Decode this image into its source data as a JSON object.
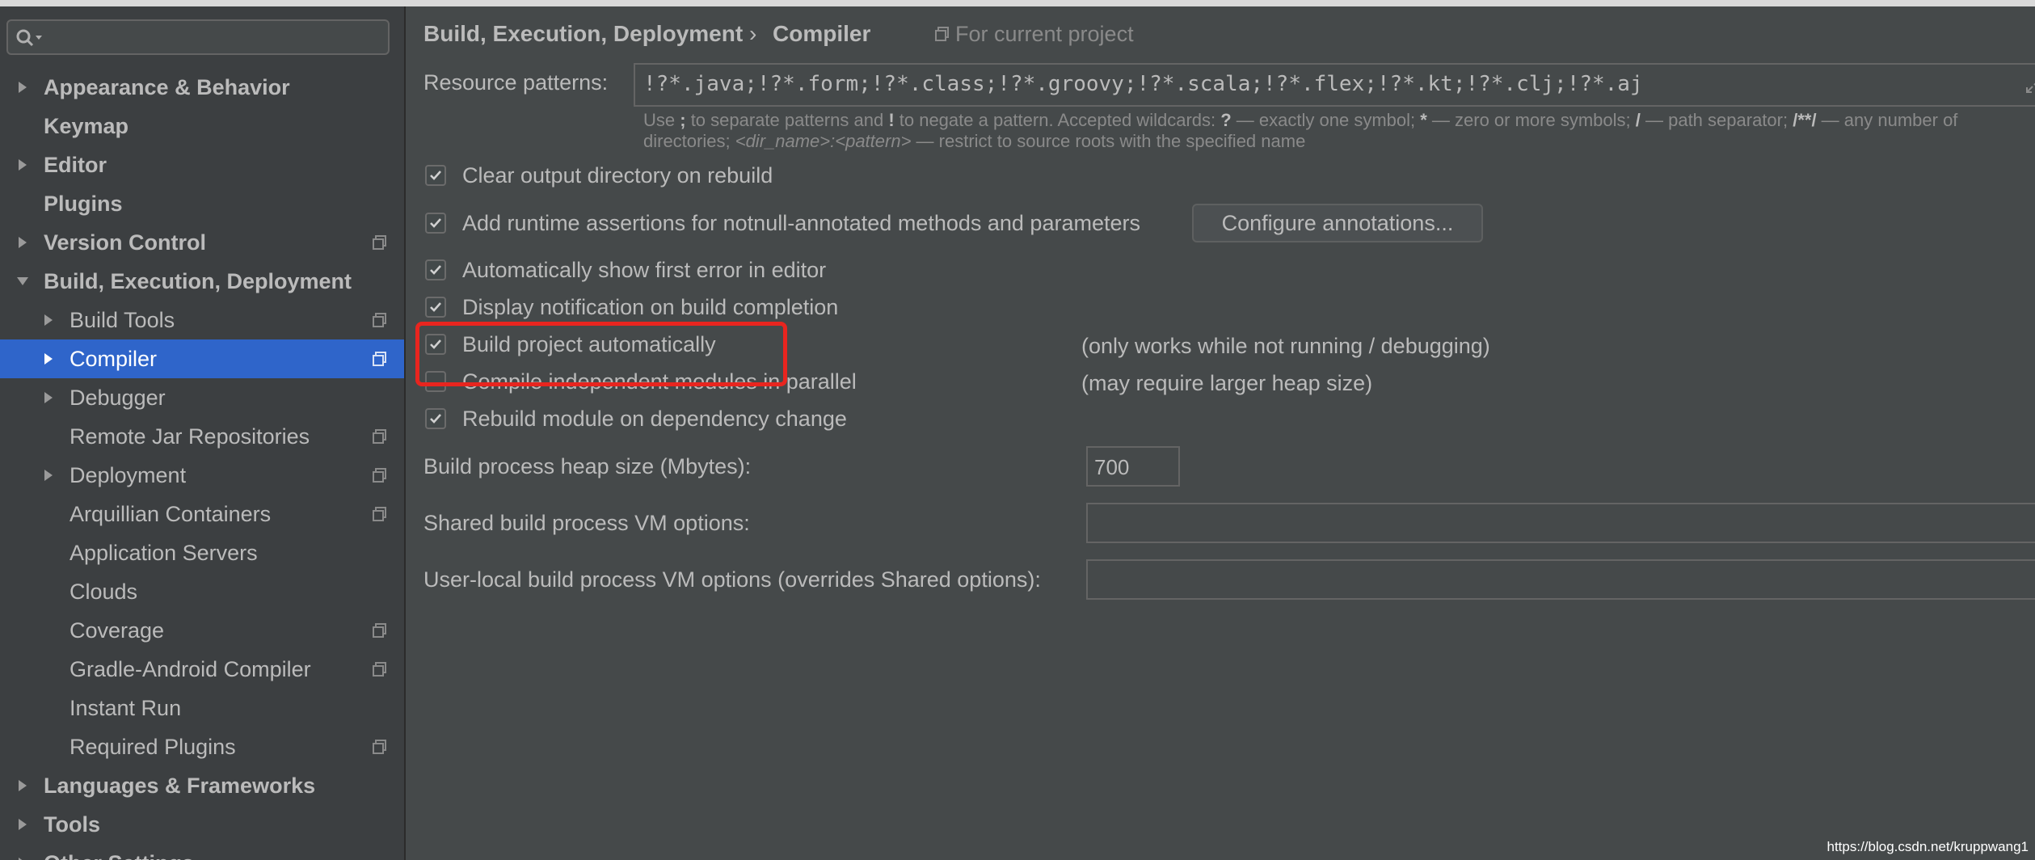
{
  "search": {
    "placeholder": "",
    "value": ""
  },
  "sidebar": {
    "items": [
      {
        "label": "Appearance & Behavior",
        "level": 0,
        "expandable": true,
        "expanded": false,
        "project_icon": false
      },
      {
        "label": "Keymap",
        "level": 0,
        "expandable": false,
        "expanded": false,
        "project_icon": false
      },
      {
        "label": "Editor",
        "level": 0,
        "expandable": true,
        "expanded": false,
        "project_icon": false
      },
      {
        "label": "Plugins",
        "level": 0,
        "expandable": false,
        "expanded": false,
        "project_icon": false
      },
      {
        "label": "Version Control",
        "level": 0,
        "expandable": true,
        "expanded": false,
        "project_icon": true
      },
      {
        "label": "Build, Execution, Deployment",
        "level": 0,
        "expandable": true,
        "expanded": true,
        "project_icon": false
      },
      {
        "label": "Build Tools",
        "level": 1,
        "expandable": true,
        "expanded": false,
        "project_icon": true
      },
      {
        "label": "Compiler",
        "level": 1,
        "expandable": true,
        "expanded": false,
        "project_icon": true,
        "selected": true
      },
      {
        "label": "Debugger",
        "level": 1,
        "expandable": true,
        "expanded": false,
        "project_icon": false
      },
      {
        "label": "Remote Jar Repositories",
        "level": 1,
        "expandable": false,
        "expanded": false,
        "project_icon": true
      },
      {
        "label": "Deployment",
        "level": 1,
        "expandable": true,
        "expanded": false,
        "project_icon": true
      },
      {
        "label": "Arquillian Containers",
        "level": 1,
        "expandable": false,
        "expanded": false,
        "project_icon": true
      },
      {
        "label": "Application Servers",
        "level": 1,
        "expandable": false,
        "expanded": false,
        "project_icon": false
      },
      {
        "label": "Clouds",
        "level": 1,
        "expandable": false,
        "expanded": false,
        "project_icon": false
      },
      {
        "label": "Coverage",
        "level": 1,
        "expandable": false,
        "expanded": false,
        "project_icon": true
      },
      {
        "label": "Gradle-Android Compiler",
        "level": 1,
        "expandable": false,
        "expanded": false,
        "project_icon": true
      },
      {
        "label": "Instant Run",
        "level": 1,
        "expandable": false,
        "expanded": false,
        "project_icon": false
      },
      {
        "label": "Required Plugins",
        "level": 1,
        "expandable": false,
        "expanded": false,
        "project_icon": true
      },
      {
        "label": "Languages & Frameworks",
        "level": 0,
        "expandable": true,
        "expanded": false,
        "project_icon": false
      },
      {
        "label": "Tools",
        "level": 0,
        "expandable": true,
        "expanded": false,
        "project_icon": false
      },
      {
        "label": "Other Settings",
        "level": 0,
        "expandable": true,
        "expanded": false,
        "project_icon": false
      }
    ]
  },
  "header": {
    "breadcrumb_parent": "Build, Execution, Deployment",
    "breadcrumb_separator": "›",
    "breadcrumb_current": "Compiler",
    "scope_note": "For current project"
  },
  "resource_patterns": {
    "label": "Resource patterns:",
    "value": "!?*.java;!?*.form;!?*.class;!?*.groovy;!?*.scala;!?*.flex;!?*.kt;!?*.clj;!?*.aj"
  },
  "hint": {
    "l1_a": "Use ",
    "l1_b": ";",
    "l1_c": " to separate patterns and ",
    "l1_d": "!",
    "l1_e": " to negate a pattern. Accepted wildcards: ",
    "l1_f": "?",
    "l1_g": " — exactly one symbol; ",
    "l1_h": "*",
    "l1_i": " — zero or more symbols; ",
    "l1_j": "/",
    "l1_k": " — path separator; ",
    "l1_l": "/**/",
    "l1_m": " — any number of",
    "l2_a": "directories; ",
    "l2_b": "<dir_name>:<pattern>",
    "l2_c": " — restrict to source roots with the specified name"
  },
  "options": {
    "clear_output": {
      "label": "Clear output directory on rebuild",
      "checked": true
    },
    "runtime_assertions": {
      "label": "Add runtime assertions for notnull-annotated methods and parameters",
      "checked": true
    },
    "configure_annotations": "Configure annotations...",
    "show_first_error": {
      "label": "Automatically show first error in editor",
      "checked": true
    },
    "display_notification": {
      "label": "Display notification on build completion",
      "checked": true
    },
    "build_automatically": {
      "label": "Build project automatically",
      "checked": true,
      "note": "(only works while not running / debugging)"
    },
    "compile_parallel": {
      "label": "Compile independent modules in parallel",
      "checked": false,
      "note": "(may require larger heap size)"
    },
    "rebuild_on_dependency": {
      "label": "Rebuild module on dependency change",
      "checked": true
    }
  },
  "heap": {
    "label": "Build process heap size (Mbytes):",
    "value": "700"
  },
  "shared_vm": {
    "label": "Shared build process VM options:",
    "value": ""
  },
  "user_vm": {
    "label": "User-local build process VM options (overrides Shared options):",
    "value": ""
  },
  "watermark": "https://blog.csdn.net/kruppwang1",
  "colors": {
    "selection": "#2f65ca",
    "highlight_box": "#e8251f",
    "panel": "#45494a",
    "sidebar": "#3c3f41"
  }
}
